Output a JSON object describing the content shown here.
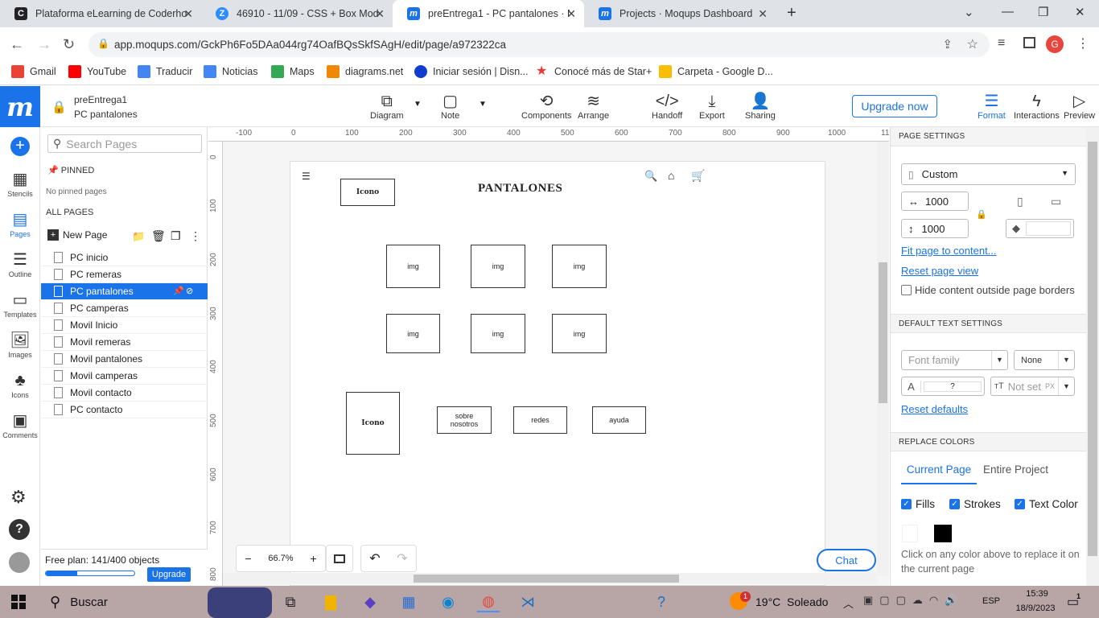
{
  "browser": {
    "tabs": [
      {
        "title": "Plataforma eLearning de Coderho",
        "icon": "coderhouse-icon",
        "color": "#222222",
        "glyph": "C"
      },
      {
        "title": "46910 - 11/09 - CSS + Box Mode",
        "icon": "zoom-icon",
        "color": "#2d8cff",
        "glyph": "Z"
      },
      {
        "title": "preEntrega1 - PC pantalones · M",
        "icon": "moqups-icon",
        "color": "#1a73e8",
        "glyph": "m"
      },
      {
        "title": "Projects · Moqups Dashboard",
        "icon": "moqups-icon",
        "color": "#1a73e8",
        "glyph": "m"
      }
    ],
    "url": "app.moqups.com/GckPh6Fo5DAa044rg74OafBQsSkfSAgH/edit/page/a972322ca",
    "bookmarks": [
      {
        "label": "Gmail",
        "icon": "gmail-icon",
        "color": "#ea4335"
      },
      {
        "label": "YouTube",
        "icon": "youtube-icon",
        "color": "#ff0000"
      },
      {
        "label": "Traducir",
        "icon": "translate-icon",
        "color": "#4285f4"
      },
      {
        "label": "Noticias",
        "icon": "news-icon",
        "color": "#4285f4"
      },
      {
        "label": "Maps",
        "icon": "maps-icon",
        "color": "#34a853"
      },
      {
        "label": "diagrams.net",
        "icon": "diagrams-icon",
        "color": "#f08705"
      },
      {
        "label": "Iniciar sesión | Disn...",
        "icon": "disney-icon",
        "color": "#113ccf"
      },
      {
        "label": "Conocé más de Star+",
        "icon": "star-icon",
        "color": "#e53935"
      },
      {
        "label": "Carpeta - Google D...",
        "icon": "drive-icon",
        "color": "#fbbc04"
      }
    ],
    "avatar_letter": "G"
  },
  "app": {
    "project_name": "preEntrega1",
    "page_name": "PC pantalones",
    "toolbar": {
      "diagram": "Diagram",
      "note": "Note",
      "components": "Components",
      "arrange": "Arrange",
      "handoff": "Handoff",
      "export": "Export",
      "sharing": "Sharing",
      "upgrade_now": "Upgrade now",
      "format": "Format",
      "interactions": "Interactions",
      "preview": "Preview"
    },
    "rail": {
      "stencils": "Stencils",
      "pages": "Pages",
      "outline": "Outline",
      "templates": "Templates",
      "images": "Images",
      "icons": "Icons",
      "comments": "Comments"
    },
    "pages_panel": {
      "search_placeholder": "Search Pages",
      "pinned": "PINNED",
      "no_pinned": "No pinned pages",
      "all_pages": "ALL PAGES",
      "new_page": "New Page",
      "pages": [
        "PC inicio",
        "PC remeras",
        "PC pantalones",
        "PC camperas",
        "Movil Inicio",
        "Movil remeras",
        "Movil pantalones",
        "Movil camperas",
        "Movil contacto",
        "PC contacto"
      ],
      "selected_index": 2,
      "free_plan": "Free plan: 141/400 objects",
      "free_plan_progress": 0.35,
      "upgrade": "Upgrade"
    },
    "canvas": {
      "ruler_top": [
        "-100",
        "0",
        "100",
        "200",
        "300",
        "400",
        "500",
        "600",
        "700",
        "800",
        "900",
        "1000",
        "11"
      ],
      "ruler_left": [
        "0",
        "100",
        "200",
        "300",
        "400",
        "500",
        "600",
        "700",
        "800"
      ],
      "title": "PANTALONES",
      "icon_top": "Icono",
      "img_label": "img",
      "icon_bottom": "Icono",
      "footer_links": [
        "sobre nosotros",
        "redes",
        "ayuda"
      ],
      "zoom": "66.7%",
      "chat": "Chat"
    },
    "format_panel": {
      "page_settings": "PAGE SETTINGS",
      "size_preset": "Custom",
      "width": "1000",
      "height": "1000",
      "fit_page": "Fit page to content...",
      "reset_view": "Reset page view",
      "hide_outside": "Hide content outside page borders",
      "default_text": "DEFAULT TEXT SETTINGS",
      "font_family_placeholder": "Font family",
      "font_weight": "None",
      "font_letter": "A",
      "font_question": "?",
      "font_size": "Not set",
      "font_unit": "PX",
      "reset_defaults": "Reset defaults",
      "replace_colors": "REPLACE COLORS",
      "tab_current": "Current Page",
      "tab_entire": "Entire Project",
      "fills": "Fills",
      "strokes": "Strokes",
      "text_color": "Text Color",
      "swatches": [
        "#ffffff",
        "#000000"
      ],
      "hint": "Click on any color above to replace it on the current page"
    }
  },
  "taskbar": {
    "search": "Buscar",
    "weather": "19°C  Soleado",
    "lang": "ESP",
    "time": "15:39",
    "date": "18/9/2023",
    "notif_count": "1",
    "weather_badge": "1"
  }
}
